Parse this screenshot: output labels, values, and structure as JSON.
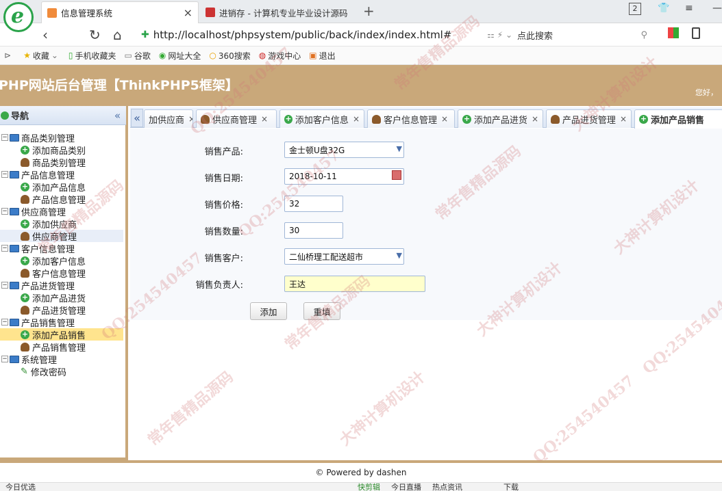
{
  "browser": {
    "tabs": [
      {
        "title": "信息管理系统",
        "active": true
      },
      {
        "title": "进销存 - 计算机专业毕业设计源码",
        "active": false
      }
    ],
    "tab_count": "2",
    "url": "http://localhost/phpsystem/public/back/index/index.html#",
    "search_placeholder": "点此搜索",
    "bookmarks": [
      "收藏",
      "手机收藏夹",
      "谷歌",
      "网址大全",
      "360搜索",
      "游戏中心",
      "退出"
    ]
  },
  "header": {
    "title": "PHP网站后台管理【ThinkPHP5框架】",
    "greeting": "您好，"
  },
  "nav": {
    "title": "导航",
    "groups": [
      {
        "label": "商品类别管理",
        "children": [
          {
            "label": "添加商品类别",
            "icon": "add"
          },
          {
            "label": "商品类别管理",
            "icon": "user"
          }
        ]
      },
      {
        "label": "产品信息管理",
        "children": [
          {
            "label": "添加产品信息",
            "icon": "add"
          },
          {
            "label": "产品信息管理",
            "icon": "user"
          }
        ]
      },
      {
        "label": "供应商管理",
        "children": [
          {
            "label": "添加供应商",
            "icon": "add"
          },
          {
            "label": "供应商管理",
            "icon": "user"
          }
        ]
      },
      {
        "label": "客户信息管理",
        "children": [
          {
            "label": "添加客户信息",
            "icon": "add"
          },
          {
            "label": "客户信息管理",
            "icon": "user"
          }
        ]
      },
      {
        "label": "产品进货管理",
        "children": [
          {
            "label": "添加产品进货",
            "icon": "add"
          },
          {
            "label": "产品进货管理",
            "icon": "user"
          }
        ]
      },
      {
        "label": "产品销售管理",
        "children": [
          {
            "label": "添加产品销售",
            "icon": "add"
          },
          {
            "label": "产品销售管理",
            "icon": "user"
          }
        ]
      },
      {
        "label": "系统管理",
        "children": [
          {
            "label": "修改密码",
            "icon": "pen"
          }
        ]
      }
    ]
  },
  "page_tabs": [
    {
      "label": "加供应商",
      "icon": "none"
    },
    {
      "label": "供应商管理",
      "icon": "user"
    },
    {
      "label": "添加客户信息",
      "icon": "add"
    },
    {
      "label": "客户信息管理",
      "icon": "user"
    },
    {
      "label": "添加产品进货",
      "icon": "add"
    },
    {
      "label": "产品进货管理",
      "icon": "user"
    },
    {
      "label": "添加产品销售",
      "icon": "add"
    }
  ],
  "form": {
    "product_label": "销售产品:",
    "product_value": "金士顿U盘32G",
    "date_label": "销售日期:",
    "date_value": "2018-10-11",
    "price_label": "销售价格:",
    "price_value": "32",
    "qty_label": "销售数量:",
    "qty_value": "30",
    "customer_label": "销售客户:",
    "customer_value": "二仙桥理工配送超市",
    "manager_label": "销售负责人:",
    "manager_value": "王达",
    "add_button": "添加",
    "reset_button": "重填"
  },
  "footer": "© Powered by dashen",
  "statusbar": {
    "items": [
      "今日优选",
      "快剪辑",
      "今日直播",
      "热点资讯",
      "下载"
    ]
  },
  "watermark": [
    "QQ:254540457",
    "常年售精品源码",
    "大神计算机设计"
  ]
}
